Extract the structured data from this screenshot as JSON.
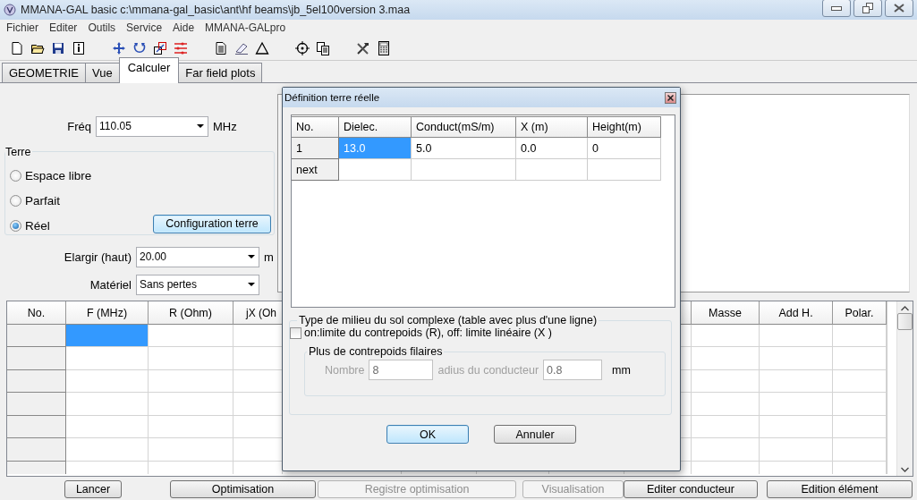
{
  "window": {
    "title": "MMANA-GAL basic c:\\mmana-gal_basic\\ant\\hf beams\\jb_5el100version 3.maa"
  },
  "menu": [
    "Fichier",
    "Editer",
    "Outils",
    "Service",
    "Aide",
    "MMANA-GALpro"
  ],
  "tabs": [
    {
      "label": "GEOMETRIE",
      "selected": false
    },
    {
      "label": "Vue",
      "selected": false
    },
    {
      "label": "Calculer",
      "selected": true
    },
    {
      "label": "Far field plots",
      "selected": false
    }
  ],
  "calculation": {
    "frequency": {
      "label": "Fréq",
      "value": "110.05",
      "unit": "MHz"
    },
    "ground": {
      "title": "Terre",
      "options": [
        {
          "label": "Espace libre",
          "selected": false
        },
        {
          "label": "Parfait",
          "selected": false
        },
        {
          "label": "Réel",
          "selected": true
        }
      ],
      "button": "Configuration terre"
    },
    "height": {
      "label": "Elargir (haut)",
      "value": "20.00",
      "unit": "m"
    },
    "material": {
      "label": "Matériel",
      "value": "Sans pertes"
    }
  },
  "results_table": {
    "columns": [
      "No.",
      "F (MHz)",
      "R (Ohm)",
      "jX (Oh",
      "Masse",
      "Add H.",
      "Polar."
    ],
    "rows": [
      {
        "selected": true
      },
      {
        "selected": false
      },
      {
        "selected": false
      },
      {
        "selected": false
      },
      {
        "selected": false
      },
      {
        "selected": false
      },
      {
        "selected": false
      }
    ]
  },
  "bottom_buttons": [
    {
      "label": "Lancer",
      "disabled": false
    },
    {
      "label": "Optimisation",
      "disabled": false
    },
    {
      "label": "Registre optimisation",
      "disabled": true
    },
    {
      "label": "Visualisation",
      "disabled": true
    },
    {
      "label": "Editer conducteur",
      "disabled": false
    },
    {
      "label": "Edition élément",
      "disabled": false
    }
  ],
  "dialog": {
    "title": "Définition terre réelle",
    "row_header_title": "No.",
    "columns": [
      "Dielec.",
      "Conduct(mS/m)",
      "X (m)",
      "Height(m)"
    ],
    "rows": [
      {
        "no": "1",
        "cells": [
          {
            "text": "13.0",
            "selected": true
          },
          {
            "text": "5.0",
            "selected": false
          },
          {
            "text": "0.0",
            "selected": false
          },
          {
            "text": "0",
            "selected": false
          }
        ]
      },
      {
        "no": "next",
        "cells": []
      }
    ],
    "medium_group": {
      "title": "Type de milieu du sol complexe (table avec plus d'une ligne)",
      "checkbox": {
        "label": "on:limite du contrepoids (R), off: limite linéaire (X )",
        "checked": false
      },
      "counterpoise": {
        "title": "Plus de contrepoids filaires",
        "disabled": true,
        "count": {
          "label": "Nombre",
          "value": "8"
        },
        "radius": {
          "label": "adius du conducteur",
          "value": "0.8",
          "unit": "mm"
        }
      }
    },
    "buttons": [
      {
        "label": "OK",
        "default": true
      },
      {
        "label": "Annuler",
        "default": false
      }
    ]
  }
}
